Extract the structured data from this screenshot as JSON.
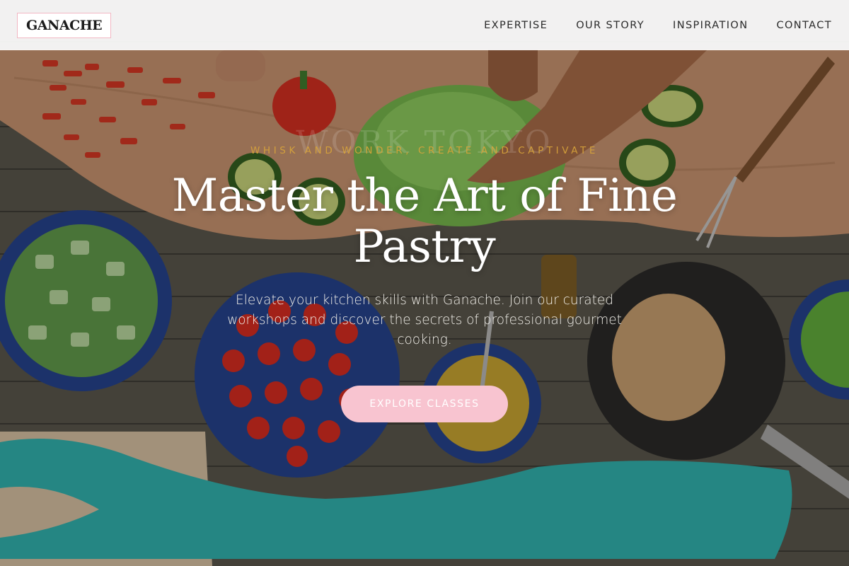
{
  "brand": {
    "logo_text": "GANACHE",
    "accent": "#f8c4d0",
    "eyebrow_color": "#d9a53a"
  },
  "nav": {
    "items": [
      {
        "label": "EXPERTISE"
      },
      {
        "label": "OUR STORY"
      },
      {
        "label": "INSPIRATION"
      },
      {
        "label": "CONTACT"
      }
    ]
  },
  "hero": {
    "eyebrow": "WHISK AND WONDER, CREATE AND CAPTIVATE",
    "headline": "Master the Art of Fine Pastry",
    "watermark": "WORK TOKYO",
    "subtext": "Elevate your kitchen skills with Ganache. Join our curated workshops and discover the secrets of professional gourmet cooking.",
    "cta_label": "EXPLORE CLASSES",
    "background_image": "overhead-table-vegetables-photo"
  }
}
